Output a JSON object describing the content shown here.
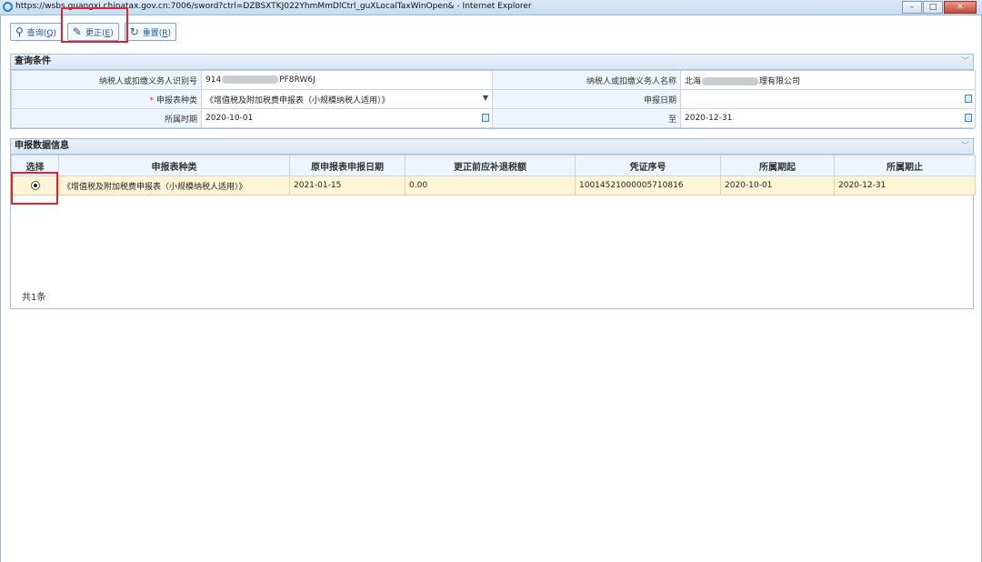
{
  "window": {
    "title": "https://wsbs.guangxi.chinatax.gov.cn:7006/sword?ctrl=DZBSXTKJ022YhmMmDlCtrl_guXLocalTaxWinOpen& - Internet Explorer",
    "min_glyph": "–",
    "max_glyph": "□",
    "close_glyph": "✕"
  },
  "toolbar": {
    "query_label": "查询(",
    "query_key": "Q",
    "correct_label": "更正(",
    "correct_key": "E",
    "reset_label": "重置(",
    "reset_key": "R",
    "close_paren": ")"
  },
  "query_panel": {
    "title": "查询条件",
    "taxpayer_id_label": "纳税人或扣缴义务人识别号",
    "taxpayer_id_prefix": "914",
    "taxpayer_id_suffix": "PF8RW6J",
    "taxpayer_name_label": "纳税人或扣缴义务人名称",
    "taxpayer_name_prefix": "北海",
    "taxpayer_name_suffix": "理有限公司",
    "form_type_label": "申报表种类",
    "required_mark": "*",
    "form_type_value": "《增值税及附加税费申报表（小规模纳税人适用）》",
    "report_date_label": "申报日期",
    "report_date_value": "",
    "period_label": "所属时期",
    "period_start": "2020-10-01",
    "period_to_label": "至",
    "period_end": "2020-12-31"
  },
  "data_panel": {
    "title": "申报数据信息",
    "columns": [
      "选择",
      "申报表种类",
      "原申报表申报日期",
      "更正前应补退税额",
      "凭证序号",
      "所属期起",
      "所属期止"
    ],
    "rows": [
      {
        "form_type": "《增值税及附加税费申报表（小规模纳税人适用）》",
        "original_date": "2021-01-15",
        "tax_before": "0.00",
        "voucher_no": "10014521000005710816",
        "period_start": "2020-10-01",
        "period_end": "2020-12-31",
        "selected": true
      }
    ],
    "total_label": "共1条"
  },
  "colors": {
    "accent": "#1c5aa6",
    "highlight_box": "#e0252b",
    "selected_row": "#fdf3d6"
  }
}
